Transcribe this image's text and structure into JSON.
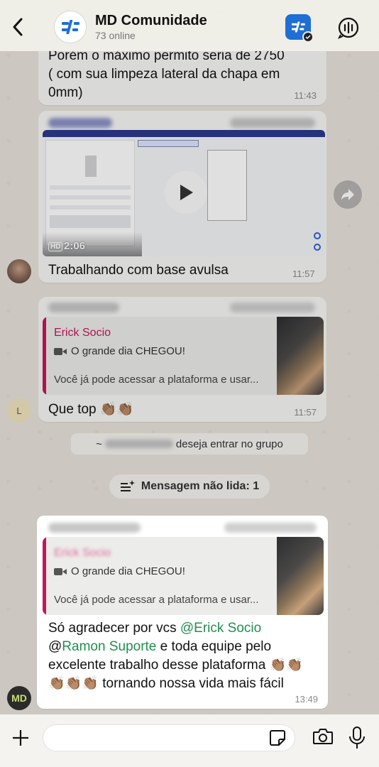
{
  "header": {
    "title": "MD Comunidade",
    "subtitle": "73 online"
  },
  "messages": {
    "m1": {
      "line1": "Porém o máximo permito seria de 2750",
      "line2": "( com sua limpeza lateral da chapa em",
      "line3": "0mm)",
      "time": "11:43"
    },
    "m2": {
      "duration": "2:06",
      "hd": "HD",
      "text": "Trabalhando com base avulsa",
      "time": "11:57"
    },
    "m3": {
      "quote_author": "Erick Socio",
      "quote_title": "O grande dia CHEGOU!",
      "quote_preview": "Você já pode acessar a plataforma e usar...",
      "text": "Que top 👏🏽👏🏽",
      "avatar_letter": "L",
      "time": "11:57"
    },
    "system": {
      "join_prefix": "~",
      "join_suffix": "deseja entrar no grupo",
      "unread_label": "Mensagem não lida: 1"
    },
    "m4": {
      "quote_author": "Erick Socio",
      "quote_title": "O grande dia CHEGOU!",
      "quote_preview": "Você já pode acessar a plataforma e usar...",
      "line1_pre": "Só agradecer por vcs ",
      "mention1": "@Erick Socio",
      "mention2_at": "@",
      "mention2": "Ramon Suporte",
      "line2_post": " e toda equipe pelo",
      "line3": "excelente trabalho desse plataforma 👏🏽👏🏽",
      "line4": "👏🏽👏🏽👏🏽 tornando nossa vida mais fácil",
      "time": "13:49",
      "avatar_logo": "MD"
    }
  },
  "composer": {
    "placeholder": ""
  },
  "colors": {
    "accent_green": "#1f8f4e",
    "quote_pink": "#c2185b",
    "brand_blue": "#1f6ed4"
  }
}
